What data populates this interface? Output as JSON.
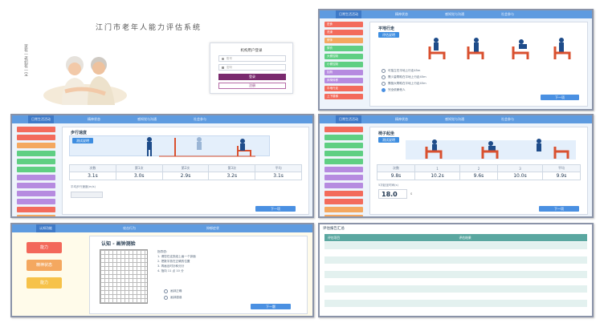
{
  "login": {
    "title": "江门市老年人能力评估系统",
    "form_title": "机构用户登录",
    "username_placeholder": "账号",
    "password_placeholder": "密码",
    "login_button": "登录",
    "register_button": "注册",
    "calligraphy": "家有一老如有一宝"
  },
  "p2": {
    "nav": [
      "日常生活活动",
      "精神状态",
      "感知觉与沟通",
      "社会参与"
    ],
    "sidebar": [
      "进食",
      "洗澡",
      "修饰",
      "穿衣",
      "大便控制",
      "小便控制",
      "如厕",
      "床椅转移",
      "平地行走",
      "上下楼梯"
    ],
    "title": "平地行走",
    "chip": "评估说明",
    "options": [
      "可独立在平地上行走45m",
      "需少量帮助在平地上行走45m",
      "需极大帮助在平地上行走45m",
      "完全依赖他人"
    ],
    "next": "下一项"
  },
  "p3": {
    "nav": [
      "日常生活活动",
      "精神状态",
      "感知觉与沟通",
      "社会参与"
    ],
    "title": "步行速度",
    "chip": "测试说明",
    "headers": [
      "次数",
      "第1次",
      "第2次",
      "第3次",
      "平均"
    ],
    "values": [
      "3.1s",
      "3.0s",
      "2.9s",
      "3.2s",
      "3.1s"
    ],
    "input_label": "平均步行速度(m/s)",
    "next": "下一项"
  },
  "p4": {
    "nav": [
      "日常生活活动",
      "精神状态",
      "感知觉与沟通",
      "社会参与"
    ],
    "title": "椅子起坐",
    "chip": "测试说明",
    "headers": [
      "次数",
      "1",
      "2",
      "3",
      "平均"
    ],
    "values": [
      "9.8s",
      "10.2s",
      "9.6s",
      "10.0s",
      "9.9s"
    ],
    "result_label": "5次起坐时间(s)",
    "result_value": "18.0",
    "result_unit": "s",
    "next": "下一项"
  },
  "p5": {
    "nav": [
      "认知功能",
      "攻击行为",
      "抑郁症状"
    ],
    "buttons": [
      "能力",
      "精神状态",
      "能力"
    ],
    "title": "认知 - 画钟测验",
    "instructions": [
      "指导语：",
      "1. 请您在这张纸上画一个钟面",
      "2. 把数字放在正确的位置",
      "3. 再画出时针和分针",
      "4. 指向 11 点 10 分"
    ],
    "options": [
      "画钟正确",
      "画钟错误"
    ],
    "next": "下一题"
  },
  "p6": {
    "title": "评估报告汇总",
    "col_headers": [
      "评估项目",
      "评估结果"
    ]
  },
  "colors": {
    "accent": "#4a90e2",
    "topbar": "#5e9be0",
    "login_button": "#7a2a6e",
    "side_red": "#f36b5c",
    "side_green": "#5fcf83",
    "side_purple": "#b68be0",
    "side_orange": "#f4a860",
    "chair": "#d9502f",
    "figure": "#1e4c8a"
  }
}
